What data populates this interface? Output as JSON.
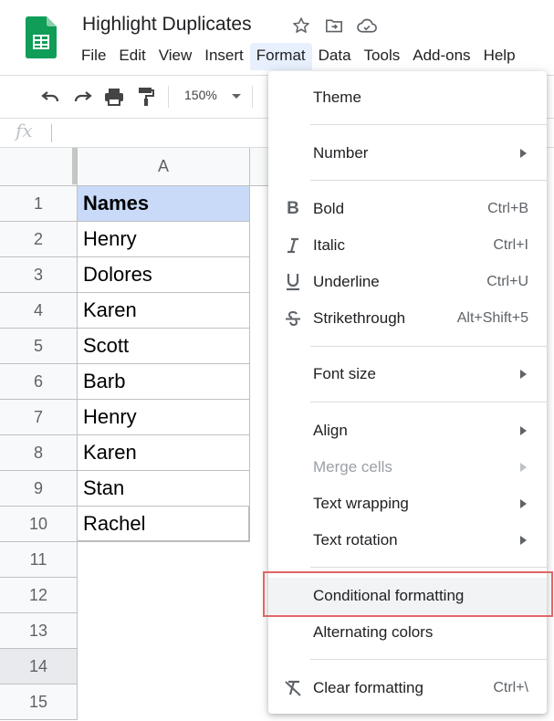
{
  "app": {
    "title": "Highlight Duplicates",
    "icons": [
      "star-icon",
      "move-to-folder-icon",
      "cloud-status-icon"
    ],
    "accent_color": "#0f9d58"
  },
  "menubar": {
    "items": [
      {
        "label": "File"
      },
      {
        "label": "Edit"
      },
      {
        "label": "View"
      },
      {
        "label": "Insert"
      },
      {
        "label": "Format",
        "active": true
      },
      {
        "label": "Data"
      },
      {
        "label": "Tools"
      },
      {
        "label": "Add-ons"
      },
      {
        "label": "Help"
      }
    ]
  },
  "toolbar": {
    "icons": [
      "undo-icon",
      "redo-icon",
      "print-icon",
      "paint-format-icon"
    ],
    "zoom": "150%"
  },
  "formula_bar": {
    "fx_label": "fx",
    "value": ""
  },
  "sheet": {
    "column_header": "A",
    "rows": [
      {
        "num": "1",
        "value": "Names",
        "header": true
      },
      {
        "num": "2",
        "value": "Henry"
      },
      {
        "num": "3",
        "value": "Dolores"
      },
      {
        "num": "4",
        "value": "Karen"
      },
      {
        "num": "5",
        "value": "Scott"
      },
      {
        "num": "6",
        "value": "Barb"
      },
      {
        "num": "7",
        "value": "Henry"
      },
      {
        "num": "8",
        "value": "Karen"
      },
      {
        "num": "9",
        "value": "Stan"
      },
      {
        "num": "10",
        "value": "Rachel"
      },
      {
        "num": "11",
        "value": ""
      },
      {
        "num": "12",
        "value": ""
      },
      {
        "num": "13",
        "value": ""
      },
      {
        "num": "14",
        "value": ""
      },
      {
        "num": "15",
        "value": ""
      }
    ],
    "header_fill": "#c9daf8"
  },
  "format_menu": {
    "theme": "Theme",
    "number": "Number",
    "bold": {
      "label": "Bold",
      "shortcut": "Ctrl+B",
      "icon": "bold-icon"
    },
    "italic": {
      "label": "Italic",
      "shortcut": "Ctrl+I",
      "icon": "italic-icon"
    },
    "underline": {
      "label": "Underline",
      "shortcut": "Ctrl+U",
      "icon": "underline-icon"
    },
    "strikethrough": {
      "label": "Strikethrough",
      "shortcut": "Alt+Shift+5",
      "icon": "strikethrough-icon"
    },
    "font_size": "Font size",
    "align": "Align",
    "merge_cells": "Merge cells",
    "text_wrapping": "Text wrapping",
    "text_rotation": "Text rotation",
    "conditional_formatting": "Conditional formatting",
    "alternating_colors": "Alternating colors",
    "clear_formatting": {
      "label": "Clear formatting",
      "shortcut": "Ctrl+\\",
      "icon": "clear-formatting-icon"
    },
    "highlight_box_color": "#e06666"
  }
}
